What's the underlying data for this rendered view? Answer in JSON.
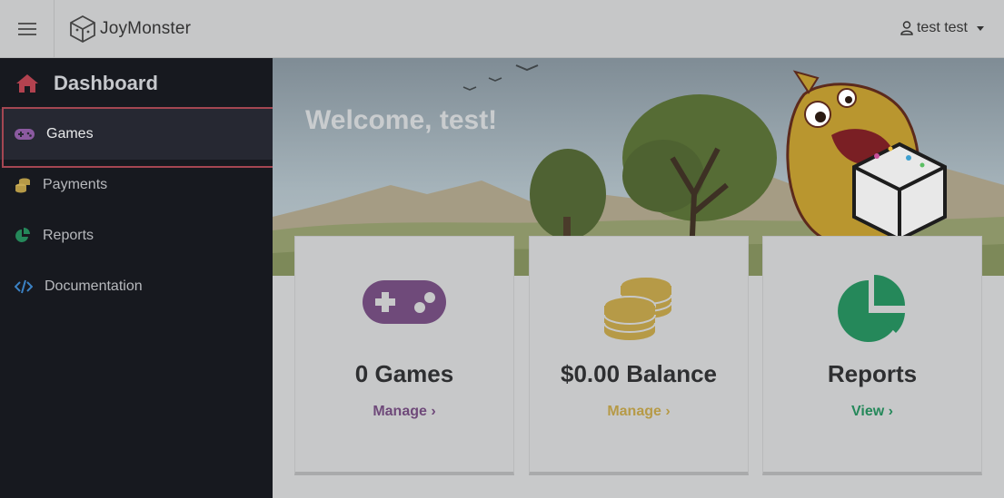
{
  "header": {
    "brand": "JoyMonster",
    "user_name": "test test",
    "icons": {
      "menu": "hamburger-icon",
      "logo": "dice-icon",
      "user": "user-icon",
      "caret": "caret-down-icon"
    }
  },
  "sidebar": {
    "heading": "Dashboard",
    "heading_icon": "home-icon",
    "items": [
      {
        "label": "Games",
        "icon": "gamepad-icon",
        "active": true
      },
      {
        "label": "Payments",
        "icon": "coins-icon",
        "active": false
      },
      {
        "label": "Reports",
        "icon": "pie-chart-icon",
        "active": false
      },
      {
        "label": "Documentation",
        "icon": "code-icon",
        "active": false
      }
    ]
  },
  "main": {
    "welcome": "Welcome, test!",
    "cards": [
      {
        "title": "0 Games",
        "link": "Manage ›",
        "icon": "gamepad-icon",
        "color": "#6f4a7a"
      },
      {
        "title": "$0.00 Balance",
        "link": "Manage ›",
        "icon": "coins-icon",
        "color": "#b69a47"
      },
      {
        "title": "Reports",
        "link": "View ›",
        "icon": "pie-chart-icon",
        "color": "#25885a"
      }
    ]
  },
  "colors": {
    "sidebar_bg": "#17191f",
    "active_border": "#a44652",
    "home_icon": "#b2424f",
    "games": "#6f4a7a",
    "payments": "#b69a47",
    "reports": "#25885a",
    "docs": "#3b82c4"
  }
}
